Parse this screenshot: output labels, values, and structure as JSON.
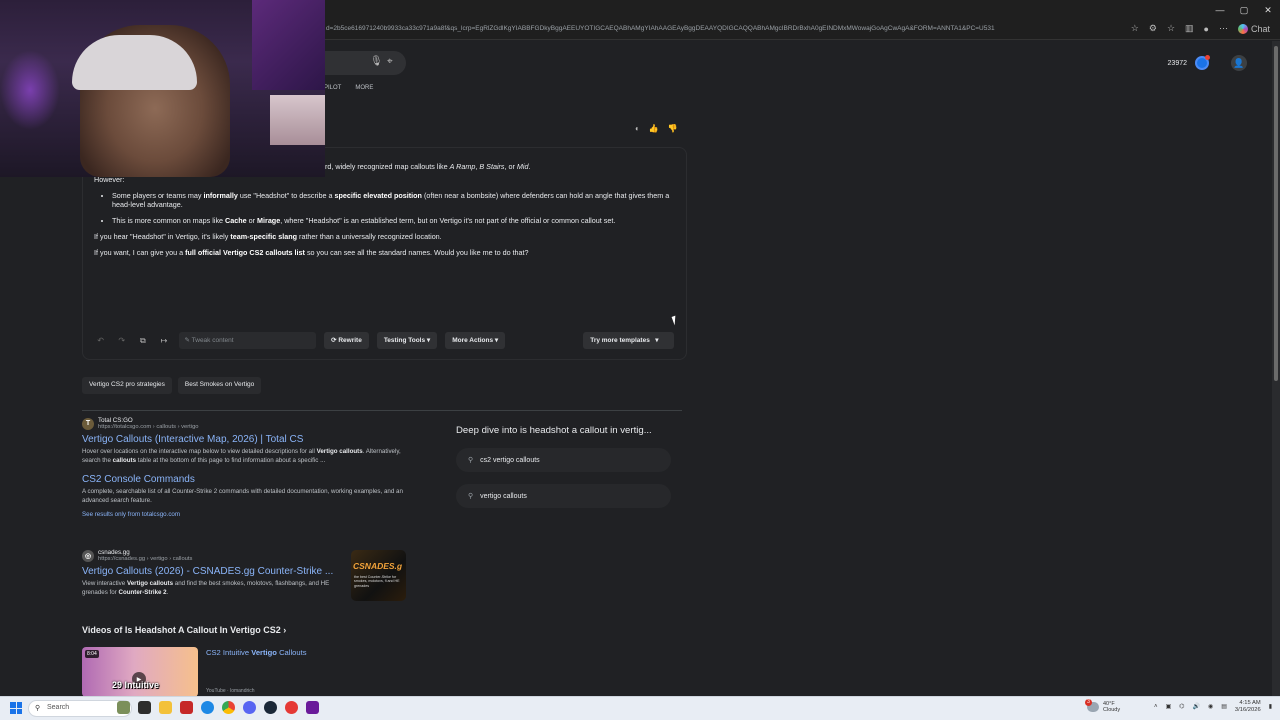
{
  "browser": {
    "url": "d=2b5ce616971240b9933ca33c971a9a8f&qs_lcrp=EgRlZGdlKgYIABBFGDkyBggAEEUYOTIGCAEQABhAMgYIAhAAGEAyBggDEAAYQDIGCAQQABhAMgcIBRDrBxhA0gEINDMxMWowajGoAgCwAgA&FORM=ANNTA1&PC=U531",
    "chat_label": "Chat"
  },
  "header": {
    "tabs": [
      "PILOT",
      "MORE"
    ],
    "points": "23972"
  },
  "answer": {
    "intro": "rd, widely recognized map callouts like",
    "intro_callouts": [
      "A Ramp",
      "B Stairs",
      "Mid"
    ],
    "however": "However:",
    "bullet1_pre": "Some players or teams may",
    "bullet1_b1": "informally",
    "bullet1_mid": "use \"Headshot\" to describe a",
    "bullet1_b2": "specific elevated position",
    "bullet1_post": "(often near a bombsite) where defenders can hold an angle that gives them a head-level advantage.",
    "bullet2_pre": "This is more common on maps like",
    "bullet2_b1": "Cache",
    "bullet2_or": "or",
    "bullet2_b2": "Mirage",
    "bullet2_post": ", where \"Headshot\" is an established term, but on Vertigo it's not part of the official or common callout set.",
    "para1_pre": "If you hear \"Headshot\" in Vertigo, it's likely",
    "para1_b": "team-specific slang",
    "para1_post": "rather than a universally recognized location.",
    "para2_pre": "If you want, I can give you a",
    "para2_b": "full official Vertigo CS2 callouts list",
    "para2_post": "so you can see all the standard names. Would you like me to do that?"
  },
  "toolbar": {
    "tweak_placeholder": "Tweak content",
    "rewrite": "Rewrite",
    "testing_tools": "Testing Tools",
    "more_actions": "More Actions",
    "try_templates": "Try more templates"
  },
  "chips": [
    "Vertigo CS2 pro strategies",
    "Best Smokes on Vertigo"
  ],
  "results": [
    {
      "favicon": "T",
      "site": "Total CS:GO",
      "url": "https://totalcsgo.com › callouts › vertigo",
      "title": "Vertigo Callouts (Interactive Map, 2026) | Total CS",
      "snippet_pre": "Hover over locations on the interactive map below to view detailed descriptions for all",
      "snippet_b1": "Vertigo callouts",
      "snippet_mid": ". Alternatively, search the",
      "snippet_b2": "callouts",
      "snippet_post": "table at the bottom of this page to find information about a specific ...",
      "sub_title": "CS2 Console Commands",
      "sub_snippet": "A complete, searchable list of all Counter-Strike 2 commands with detailed documentation, working examples, and an advanced search feature.",
      "more": "See results only from totalcsgo.com"
    },
    {
      "site": "csnades.gg",
      "url": "https://csnades.gg › vertigo › callouts",
      "title": "Vertigo Callouts (2026) - CSNADES.gg Counter-Strike ...",
      "snippet_pre": "View interactive",
      "snippet_b1": "Vertigo callouts",
      "snippet_mid": "and find the best smokes, molotovs, flashbangs, and HE grenades for",
      "snippet_b2": "Counter-Strike 2",
      "snippet_post": ".",
      "thumb_logo": "CSNADES.g",
      "thumb_text": "the best Counter-Strike for smokes, molotovs, fl and HE grenades"
    }
  ],
  "deep_dive": {
    "title": "Deep dive into is headshot a callout in vertig...",
    "items": [
      "cs2 vertigo callouts",
      "vertigo callouts"
    ]
  },
  "videos": {
    "heading": "Videos of Is Headshot A Callout In Vertigo CS2",
    "chevron": "›",
    "duration": "8:04",
    "thumb_text": "29 Intuitive",
    "title_pre": "CS2 Intuitive",
    "title_b": "Vertigo",
    "title_post": "Callouts",
    "source": "YouTube · lomandrich"
  },
  "taskbar": {
    "search_placeholder": "Search",
    "weather_temp": "40°F",
    "weather_desc": "Cloudy",
    "weather_badge": "3",
    "time": "4:15 AM",
    "date": "3/16/2026"
  },
  "colors": {
    "link": "#8ab4f8",
    "bg": "#202124",
    "accent": "#1a73e8"
  }
}
